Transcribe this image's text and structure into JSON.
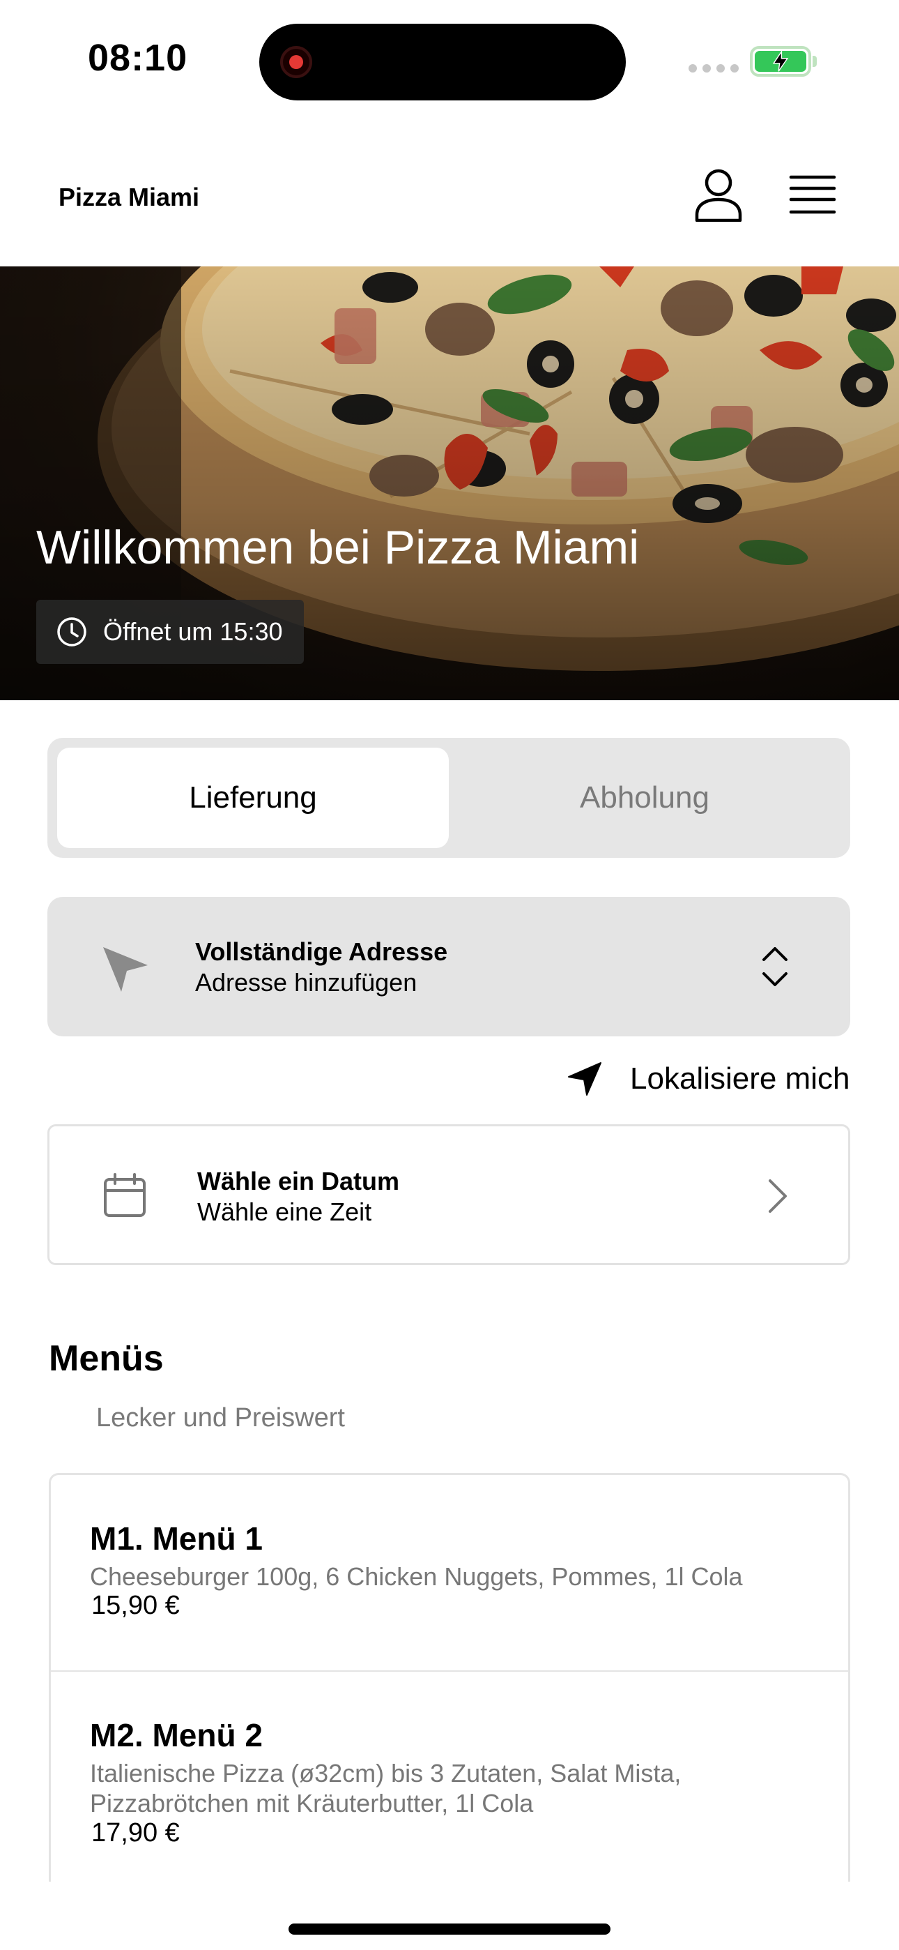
{
  "status_bar": {
    "time": "08:10",
    "icons": [
      "screen-recording-icon",
      "signal-icon",
      "battery-charging-icon"
    ]
  },
  "header": {
    "brand": "Pizza Miami",
    "icons": [
      "user-icon",
      "menu-icon"
    ]
  },
  "hero": {
    "title": "Willkommen bei Pizza Miami",
    "hours": "Öffnet um 15:30",
    "hours_icon": "clock-icon"
  },
  "mode_toggle": {
    "options": [
      {
        "label": "Lieferung",
        "selected": true
      },
      {
        "label": "Abholung",
        "selected": false
      }
    ]
  },
  "address": {
    "icon": "navigation-arrow-icon",
    "title": "Vollständige Adresse",
    "subtitle": "Adresse hinzufügen",
    "action_icon": "chevron-up-down-icon"
  },
  "locate": {
    "icon": "location-arrow-icon",
    "label": "Lokalisiere mich"
  },
  "date": {
    "icon": "calendar-icon",
    "title": "Wähle ein Datum",
    "subtitle": "Wähle eine Zeit",
    "action_icon": "chevron-right-icon"
  },
  "menus": {
    "title": "Menüs",
    "subtitle": "Lecker und Preiswert",
    "items": [
      {
        "title": "M1. Menü 1",
        "description": "Cheeseburger 100g, 6 Chicken Nuggets, Pommes, 1l Cola",
        "price": "15,90 €"
      },
      {
        "title": "M2. Menü 2",
        "description": "Italienische Pizza (ø32cm) bis 3 Zutaten, Salat Mista, Pizzabrötchen mit Kräuterbutter, 1l Cola",
        "price": "17,90 €"
      }
    ]
  },
  "colors": {
    "accent": "#000000",
    "panel_gray": "#e4e4e4",
    "muted_text": "#7a7a7a",
    "battery_green": "#34c759",
    "record_red": "#e53935"
  }
}
